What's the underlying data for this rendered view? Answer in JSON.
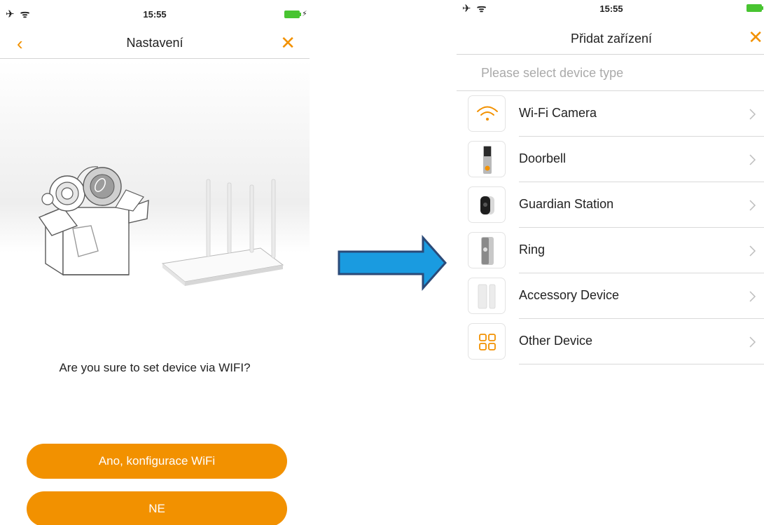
{
  "left_screen": {
    "status": {
      "time": "15:55",
      "left_icons": "✈ ᯤ",
      "battery_bolt": "⚡"
    },
    "nav": {
      "title": "Nastavení",
      "back": "‹",
      "close": "✕"
    },
    "question": "Are you sure to set device via WIFI?",
    "buttons": {
      "yes": "Ano, konfigurace WiFi",
      "no": "NE"
    }
  },
  "right_screen": {
    "status": {
      "time": "15:55",
      "left_icons": "✈ ᯤ",
      "battery_bolt": "⚡"
    },
    "nav": {
      "title": "Přidat zařízení",
      "close": "✕"
    },
    "hint": "Please select device type",
    "devices": [
      {
        "label": "Wi-Fi Camera",
        "icon": "wifi-icon"
      },
      {
        "label": "Doorbell",
        "icon": "doorbell-icon"
      },
      {
        "label": "Guardian Station",
        "icon": "guardian-station-icon"
      },
      {
        "label": "Ring",
        "icon": "ring-icon"
      },
      {
        "label": "Accessory Device",
        "icon": "accessory-icon"
      },
      {
        "label": "Other Device",
        "icon": "grid-icon"
      }
    ]
  },
  "colors": {
    "accent": "#f29100",
    "arrow_fill": "#1a9be0",
    "arrow_outline": "#2b4a78"
  }
}
